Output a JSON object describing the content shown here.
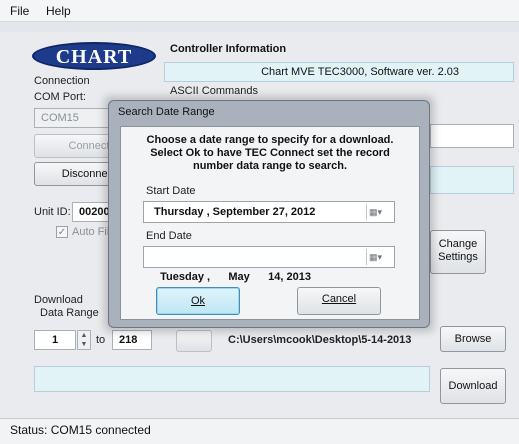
{
  "menu": {
    "file": "File",
    "help": "Help"
  },
  "logo_text": "CHART",
  "left": {
    "connection_label": "Connection",
    "com_port_label": "COM Port:",
    "com_port_value": "COM15",
    "connect_label": "Connect",
    "disconnect_label": "Disconnect",
    "unit_id_label": "Unit ID:",
    "unit_id_value": "00200",
    "auto_label": "Auto Fill",
    "download_label": "Download",
    "data_range_label": "Data Range",
    "range_from": "1",
    "range_to_label": "to",
    "range_to": "218"
  },
  "right": {
    "controller_title": "Controller Information",
    "controller_info": "Chart MVE TEC3000, Software ver. 2.03",
    "ascii_label": "ASCII Commands",
    "change_settings_label": "Change Settings",
    "path_value": "C:\\Users\\mcook\\Desktop\\5-14-2013",
    "browse_label": "Browse",
    "download_button": "Download"
  },
  "status": "Status: COM15 connected",
  "dialog": {
    "title": "Search Date Range",
    "message_line1": "Choose a date range to specify for a download.",
    "message_line2": "Select Ok to have TEC Connect set the record",
    "message_line3": "number data range to search.",
    "start_label": "Start Date",
    "start_value": "Thursday , September 27, 2012",
    "end_label": "End Date",
    "end_value": "Tuesday ,      May      14, 2013",
    "ok_label": "Ok",
    "cancel_label": "Cancel"
  },
  "colors": {
    "logo_blue": "#1d3b8a",
    "info_cyan": "#e2f3f7",
    "ok_highlight": "#bfe6f4"
  }
}
